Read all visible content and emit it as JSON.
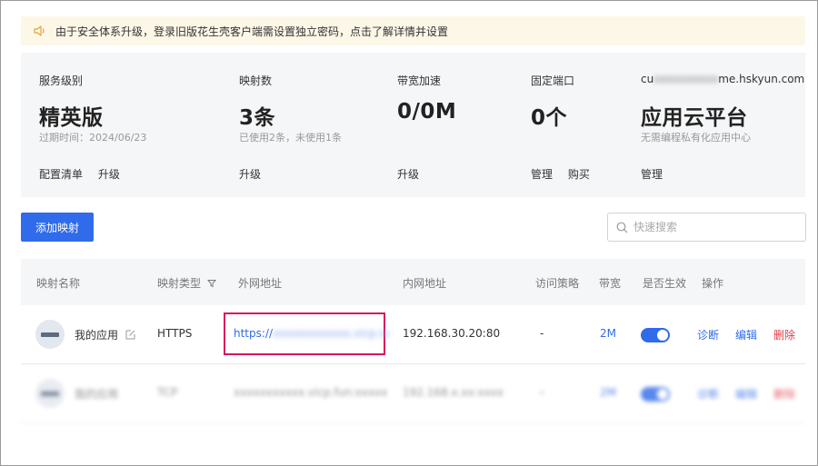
{
  "notice": {
    "text": "由于安全体系升级，登录旧版花生壳客户端需设置独立密码，点击了解详情并设置"
  },
  "stats": {
    "service": {
      "label": "服务级别",
      "value": "精英版",
      "sub": "过期时间：2024/06/23",
      "actions": [
        "配置清单",
        "升级"
      ]
    },
    "mappings": {
      "label": "映射数",
      "value": "3条",
      "sub": "已使用2条，未使用1条",
      "actions": [
        "升级"
      ]
    },
    "bandwidth": {
      "label": "带宽加速",
      "value": "0/0M",
      "sub": "",
      "actions": [
        "升级"
      ]
    },
    "port": {
      "label": "固定端口",
      "value": "0个",
      "sub": "",
      "actions": [
        "管理",
        "购买"
      ]
    },
    "cloud": {
      "label_prefix": "cu",
      "label_hidden": "xxxxxxxxxx",
      "label_suffix": "me.hskyun.com",
      "value": "应用云平台",
      "sub": "无需编程私有化应用中心",
      "actions": [
        "管理"
      ]
    }
  },
  "toolbar": {
    "add_label": "添加映射",
    "search_placeholder": "快速搜索"
  },
  "table": {
    "headers": [
      "映射名称",
      "映射类型",
      "外网地址",
      "内网地址",
      "访问策略",
      "带宽",
      "是否生效",
      "操作"
    ],
    "rows": [
      {
        "name": "我的应用",
        "type": "HTTPS",
        "ext_prefix": "https://",
        "ext_hidden": "xxxxxxxxxxxx.vicp.io",
        "internal": "192.168.30.20:80",
        "policy": "-",
        "bandwidth": "2M",
        "enabled": true,
        "actions": [
          "诊断",
          "编辑",
          "删除"
        ]
      },
      {
        "name": "我的应用",
        "type": "TCP",
        "ext_prefix": "",
        "ext_hidden": "xxxxxxxxxxx.vicp.fun:xxxxx",
        "internal": "192.168.x.xx:xxxx",
        "policy": "-",
        "bandwidth": "2M",
        "enabled": true,
        "actions": [
          "诊断",
          "编辑",
          "删除"
        ]
      }
    ]
  },
  "colors": {
    "primary": "#2f6bea",
    "danger": "#e23b4b",
    "highlight": "#d4185f",
    "notice_bg": "#fdf7e7",
    "panel_bg": "#f5f6f7"
  }
}
